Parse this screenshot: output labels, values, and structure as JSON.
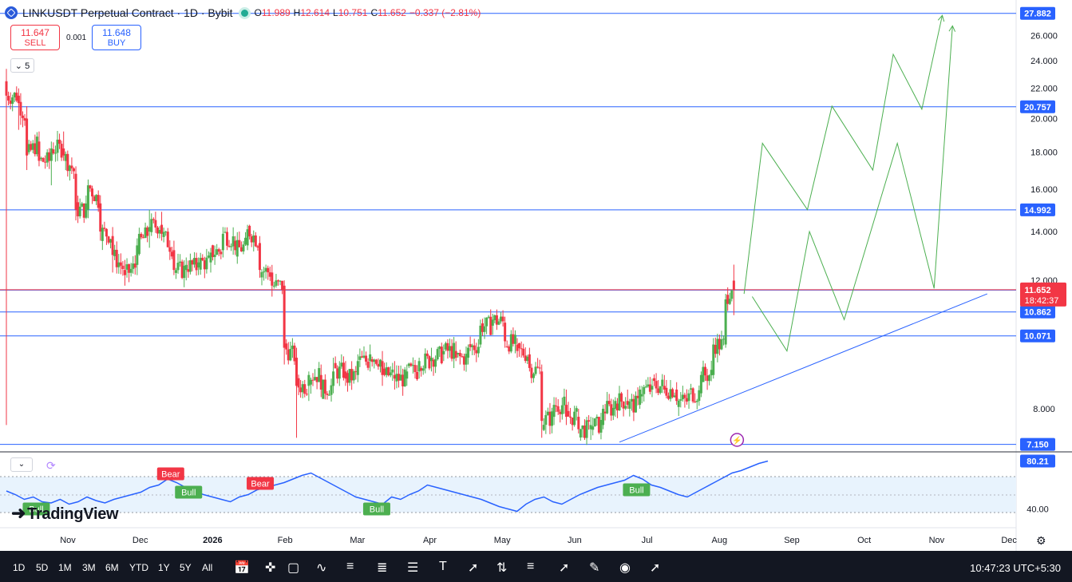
{
  "header": {
    "title": "LINKUSDT Perpetual Contract · 1D · Bybit",
    "o_label": "O",
    "o": "11.989",
    "h_label": "H",
    "h": "12.614",
    "l_label": "L",
    "l": "10.751",
    "c_label": "C",
    "c": "11.652",
    "change": "−0.337 (−2.81%)"
  },
  "trade": {
    "sell_price": "11.647",
    "sell_label": "SELL",
    "spread": "0.001",
    "buy_price": "11.648",
    "buy_label": "BUY"
  },
  "indicators_count": "5",
  "watermark": "TradingView",
  "colors": {
    "up": "#4caf50",
    "down": "#f23645",
    "line": "#2962ff",
    "projection": "#4caf50",
    "rsi": "#2962ff"
  },
  "chart_data": {
    "type": "candlestick",
    "y_scale": "log",
    "ylim": [
      7.0,
      28.5
    ],
    "y_ticks": [
      "26.000",
      "24.000",
      "22.000",
      "20.000",
      "18.000",
      "16.000",
      "14.000",
      "12.000",
      "8.000"
    ],
    "x_ticks": [
      "Nov",
      "Dec",
      "2026",
      "Feb",
      "Mar",
      "Apr",
      "May",
      "Jun",
      "Jul",
      "Aug",
      "Sep",
      "Oct",
      "Nov",
      "Dec"
    ],
    "last_price": "11.652",
    "countdown": "18:42:37",
    "levels": [
      {
        "label": "27.882",
        "value": 27.882
      },
      {
        "label": "20.757",
        "value": 20.757
      },
      {
        "label": "14.992",
        "value": 14.992
      },
      {
        "label": "11.635",
        "value": 11.635
      },
      {
        "label": "10.862",
        "value": 10.862
      },
      {
        "label": "10.071",
        "value": 10.071
      },
      {
        "label": "7.150",
        "value": 7.15
      }
    ],
    "series": [
      {
        "x": 0,
        "o": 22.5,
        "h": 23.4,
        "l": 7.6,
        "c": 21.5
      },
      {
        "x": 6,
        "o": 21.5,
        "h": 22.0,
        "l": 19.3,
        "c": 21.0
      },
      {
        "x": 10,
        "o": 20.0,
        "h": 20.8,
        "l": 17.0,
        "c": 17.8
      },
      {
        "x": 16,
        "o": 18.6,
        "h": 19.2,
        "l": 17.2,
        "c": 17.5
      },
      {
        "x": 22,
        "o": 17.5,
        "h": 18.6,
        "l": 16.2,
        "c": 18.2
      },
      {
        "x": 28,
        "o": 18.2,
        "h": 19.2,
        "l": 17.5,
        "c": 17.8
      },
      {
        "x": 34,
        "o": 16.8,
        "h": 17.2,
        "l": 14.5,
        "c": 15.0
      },
      {
        "x": 40,
        "o": 15.0,
        "h": 16.5,
        "l": 14.6,
        "c": 16.2
      },
      {
        "x": 46,
        "o": 15.3,
        "h": 15.7,
        "l": 13.6,
        "c": 14.0
      },
      {
        "x": 52,
        "o": 13.8,
        "h": 14.2,
        "l": 12.3,
        "c": 13.0
      },
      {
        "x": 58,
        "o": 12.4,
        "h": 12.8,
        "l": 11.8,
        "c": 12.2
      },
      {
        "x": 64,
        "o": 12.6,
        "h": 13.7,
        "l": 12.2,
        "c": 13.4
      },
      {
        "x": 70,
        "o": 14.0,
        "h": 15.0,
        "l": 13.3,
        "c": 14.2
      },
      {
        "x": 76,
        "o": 14.3,
        "h": 14.9,
        "l": 13.6,
        "c": 13.9
      },
      {
        "x": 82,
        "o": 13.2,
        "h": 13.6,
        "l": 12.2,
        "c": 12.4
      },
      {
        "x": 88,
        "o": 12.4,
        "h": 12.9,
        "l": 12.0,
        "c": 12.6
      },
      {
        "x": 94,
        "o": 12.5,
        "h": 12.9,
        "l": 12.2,
        "c": 12.7
      },
      {
        "x": 100,
        "o": 12.7,
        "h": 13.3,
        "l": 12.3,
        "c": 13.1
      },
      {
        "x": 106,
        "o": 13.2,
        "h": 14.2,
        "l": 12.9,
        "c": 13.9
      },
      {
        "x": 112,
        "o": 13.6,
        "h": 13.8,
        "l": 13.0,
        "c": 13.2
      },
      {
        "x": 118,
        "o": 13.4,
        "h": 14.3,
        "l": 13.2,
        "c": 14.1
      },
      {
        "x": 124,
        "o": 13.5,
        "h": 13.8,
        "l": 12.1,
        "c": 12.4
      },
      {
        "x": 130,
        "o": 12.3,
        "h": 12.6,
        "l": 11.4,
        "c": 11.8
      },
      {
        "x": 136,
        "o": 11.8,
        "h": 12.0,
        "l": 9.2,
        "c": 9.7
      },
      {
        "x": 142,
        "o": 9.4,
        "h": 9.7,
        "l": 7.3,
        "c": 8.6
      },
      {
        "x": 148,
        "o": 8.6,
        "h": 9.0,
        "l": 8.2,
        "c": 8.9
      },
      {
        "x": 154,
        "o": 8.9,
        "h": 9.2,
        "l": 8.3,
        "c": 8.5
      },
      {
        "x": 160,
        "o": 8.6,
        "h": 9.4,
        "l": 8.4,
        "c": 9.0
      },
      {
        "x": 166,
        "o": 9.0,
        "h": 9.3,
        "l": 8.6,
        "c": 8.8
      },
      {
        "x": 172,
        "o": 8.9,
        "h": 9.5,
        "l": 8.7,
        "c": 9.3
      },
      {
        "x": 178,
        "o": 9.3,
        "h": 9.8,
        "l": 9.0,
        "c": 9.5
      },
      {
        "x": 184,
        "o": 9.3,
        "h": 9.6,
        "l": 8.6,
        "c": 8.9
      },
      {
        "x": 190,
        "o": 8.9,
        "h": 9.3,
        "l": 8.5,
        "c": 8.8
      },
      {
        "x": 196,
        "o": 8.8,
        "h": 9.2,
        "l": 8.6,
        "c": 9.0
      },
      {
        "x": 202,
        "o": 9.0,
        "h": 9.4,
        "l": 8.8,
        "c": 9.3
      },
      {
        "x": 208,
        "o": 9.3,
        "h": 9.7,
        "l": 9.0,
        "c": 9.4
      },
      {
        "x": 214,
        "o": 9.5,
        "h": 9.8,
        "l": 9.3,
        "c": 9.6
      },
      {
        "x": 220,
        "o": 9.6,
        "h": 9.9,
        "l": 9.3,
        "c": 9.4
      },
      {
        "x": 226,
        "o": 9.4,
        "h": 9.8,
        "l": 9.2,
        "c": 9.7
      },
      {
        "x": 232,
        "o": 9.8,
        "h": 10.6,
        "l": 9.7,
        "c": 10.4
      },
      {
        "x": 238,
        "o": 10.4,
        "h": 10.8,
        "l": 10.1,
        "c": 10.6
      },
      {
        "x": 244,
        "o": 10.5,
        "h": 10.7,
        "l": 9.7,
        "c": 9.9
      },
      {
        "x": 250,
        "o": 9.8,
        "h": 10.0,
        "l": 9.4,
        "c": 9.6
      },
      {
        "x": 256,
        "o": 9.5,
        "h": 9.7,
        "l": 9.0,
        "c": 9.1
      },
      {
        "x": 262,
        "o": 9.0,
        "h": 9.2,
        "l": 7.3,
        "c": 7.7
      },
      {
        "x": 268,
        "o": 7.8,
        "h": 8.3,
        "l": 7.6,
        "c": 8.1
      },
      {
        "x": 274,
        "o": 8.1,
        "h": 8.5,
        "l": 7.6,
        "c": 7.8
      },
      {
        "x": 280,
        "o": 7.8,
        "h": 8.0,
        "l": 7.4,
        "c": 7.5
      },
      {
        "x": 286,
        "o": 7.5,
        "h": 7.8,
        "l": 7.25,
        "c": 7.6
      },
      {
        "x": 292,
        "o": 7.6,
        "h": 8.1,
        "l": 7.5,
        "c": 8.0
      },
      {
        "x": 298,
        "o": 8.0,
        "h": 8.3,
        "l": 7.8,
        "c": 8.2
      },
      {
        "x": 304,
        "o": 8.2,
        "h": 8.5,
        "l": 8.0,
        "c": 8.1
      },
      {
        "x": 310,
        "o": 8.1,
        "h": 8.6,
        "l": 8.0,
        "c": 8.5
      },
      {
        "x": 316,
        "o": 8.5,
        "h": 8.8,
        "l": 8.3,
        "c": 8.6
      },
      {
        "x": 322,
        "o": 8.6,
        "h": 8.9,
        "l": 8.4,
        "c": 8.5
      },
      {
        "x": 328,
        "o": 8.5,
        "h": 8.7,
        "l": 8.1,
        "c": 8.2
      },
      {
        "x": 334,
        "o": 8.2,
        "h": 8.5,
        "l": 8.0,
        "c": 8.4
      },
      {
        "x": 340,
        "o": 8.4,
        "h": 9.0,
        "l": 8.3,
        "c": 8.9
      },
      {
        "x": 346,
        "o": 8.9,
        "h": 10.0,
        "l": 8.8,
        "c": 9.8
      },
      {
        "x": 352,
        "o": 9.8,
        "h": 11.5,
        "l": 9.7,
        "c": 11.3
      },
      {
        "x": 356,
        "o": 11.99,
        "h": 12.61,
        "l": 10.75,
        "c": 11.65
      }
    ],
    "trendline": [
      {
        "x": 300,
        "v": 7.2
      },
      {
        "x": 480,
        "v": 11.5
      }
    ],
    "projections": [
      [
        {
          "x": 361,
          "v": 11.5
        },
        {
          "x": 370,
          "v": 18.5
        },
        {
          "x": 392,
          "v": 15.0
        },
        {
          "x": 404,
          "v": 20.8
        },
        {
          "x": 424,
          "v": 17.0
        },
        {
          "x": 434,
          "v": 24.5
        },
        {
          "x": 448,
          "v": 20.6
        },
        {
          "x": 458,
          "v": 27.7
        }
      ],
      [
        {
          "x": 365,
          "v": 11.4
        },
        {
          "x": 382,
          "v": 9.6
        },
        {
          "x": 393,
          "v": 14.0
        },
        {
          "x": 410,
          "v": 10.6
        },
        {
          "x": 436,
          "v": 18.5
        },
        {
          "x": 454,
          "v": 11.7
        },
        {
          "x": 463,
          "v": 26.8
        }
      ]
    ],
    "rsi": {
      "value": "80.21",
      "tick": "40.00",
      "series": [
        55,
        52,
        48,
        50,
        46,
        45,
        48,
        44,
        46,
        50,
        47,
        45,
        48,
        50,
        52,
        54,
        58,
        60,
        65,
        62,
        58,
        55,
        52,
        50,
        48,
        46,
        50,
        52,
        56,
        58,
        60,
        62,
        65,
        68,
        70,
        66,
        62,
        58,
        54,
        50,
        48,
        46,
        44,
        50,
        48,
        52,
        55,
        60,
        58,
        56,
        54,
        52,
        50,
        48,
        45,
        42,
        40,
        38,
        44,
        48,
        50,
        46,
        44,
        48,
        52,
        55,
        58,
        60,
        62,
        64,
        68,
        65,
        60,
        58,
        55,
        52,
        50,
        54,
        58,
        62,
        66,
        70,
        72,
        75,
        78,
        80
      ],
      "signals": [
        {
          "label": "Bear",
          "i": 17,
          "kind": "bear"
        },
        {
          "label": "Bull",
          "i": 19,
          "kind": "bull"
        },
        {
          "label": "Bear",
          "i": 27,
          "kind": "bear"
        },
        {
          "label": "Bull",
          "i": 2,
          "kind": "bull"
        },
        {
          "label": "Bull",
          "i": 40,
          "kind": "bull"
        },
        {
          "label": "Bull",
          "i": 69,
          "kind": "bull"
        }
      ]
    }
  },
  "toolbar": {
    "ranges": [
      "1D",
      "5D",
      "1M",
      "3M",
      "6M",
      "YTD",
      "1Y",
      "5Y",
      "All"
    ],
    "clock": "10:47:23 UTC+5:30"
  }
}
